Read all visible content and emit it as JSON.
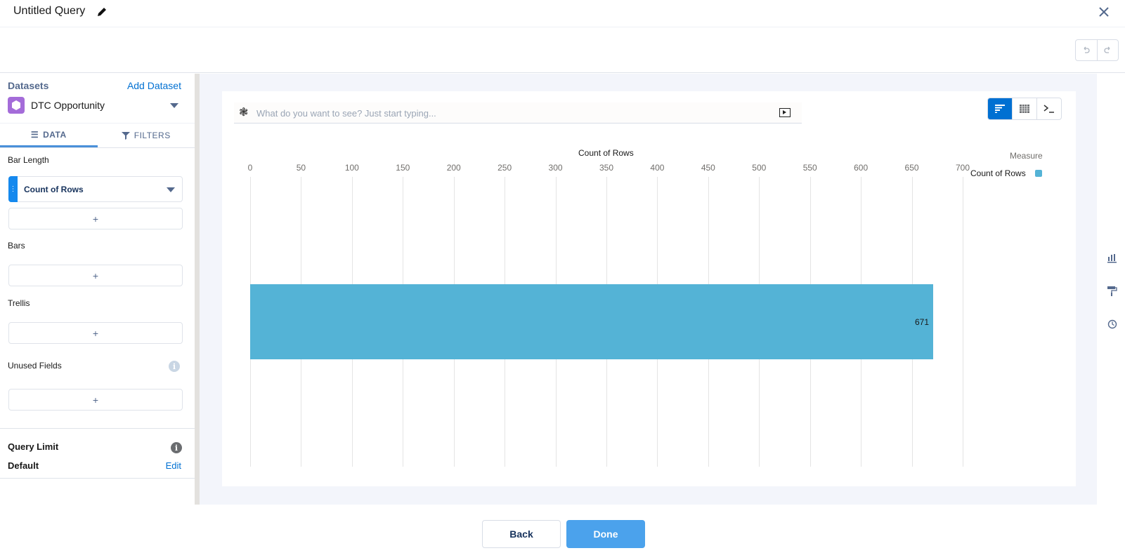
{
  "header": {
    "title": "Untitled Query",
    "edit_icon": "pencil-icon",
    "close_icon": "close-icon"
  },
  "toolbar": {
    "undo_icon": "undo-icon",
    "redo_icon": "redo-icon"
  },
  "sidebar": {
    "datasets_label": "Datasets",
    "add_dataset_label": "Add Dataset",
    "dataset_name": "DTC Opportunity",
    "tabs": [
      {
        "label": "DATA",
        "icon": "list-icon",
        "active": true
      },
      {
        "label": "FILTERS",
        "icon": "filter-icon",
        "active": false
      }
    ],
    "sections": {
      "bar_length": {
        "label": "Bar Length",
        "field": "Count of Rows",
        "add_symbol": "+"
      },
      "bars": {
        "label": "Bars",
        "add_symbol": "+"
      },
      "trellis": {
        "label": "Trellis",
        "add_symbol": "+"
      },
      "unused_fields": {
        "label": "Unused Fields",
        "add_symbol": "+"
      }
    },
    "query_limit": {
      "label": "Query Limit",
      "value": "Default",
      "edit_label": "Edit"
    }
  },
  "main": {
    "search": {
      "placeholder": "What do you want to see? Just start typing...",
      "value": ""
    },
    "view_buttons": [
      {
        "name": "chart-view",
        "active": true
      },
      {
        "name": "table-view",
        "active": false
      },
      {
        "name": "query-view",
        "active": false
      }
    ],
    "right_rail": [
      "chart-type-icon",
      "format-paint-icon",
      "history-icon"
    ]
  },
  "chart_data": {
    "type": "bar",
    "orientation": "horizontal",
    "categories": [
      ""
    ],
    "values": [
      671
    ],
    "data_labels": [
      "671"
    ],
    "title": "",
    "xlabel": "Count of Rows",
    "ylabel": "",
    "xlim": [
      0,
      700
    ],
    "ticks": [
      "0",
      "50",
      "100",
      "150",
      "200",
      "250",
      "300",
      "350",
      "400",
      "450",
      "500",
      "550",
      "600",
      "650",
      "700"
    ],
    "grid": true,
    "legend": {
      "title": "Measure",
      "items": [
        "Count of Rows"
      ],
      "placement": "top-right"
    },
    "color": "#54b3d6"
  },
  "footer": {
    "back_label": "Back",
    "done_label": "Done"
  }
}
